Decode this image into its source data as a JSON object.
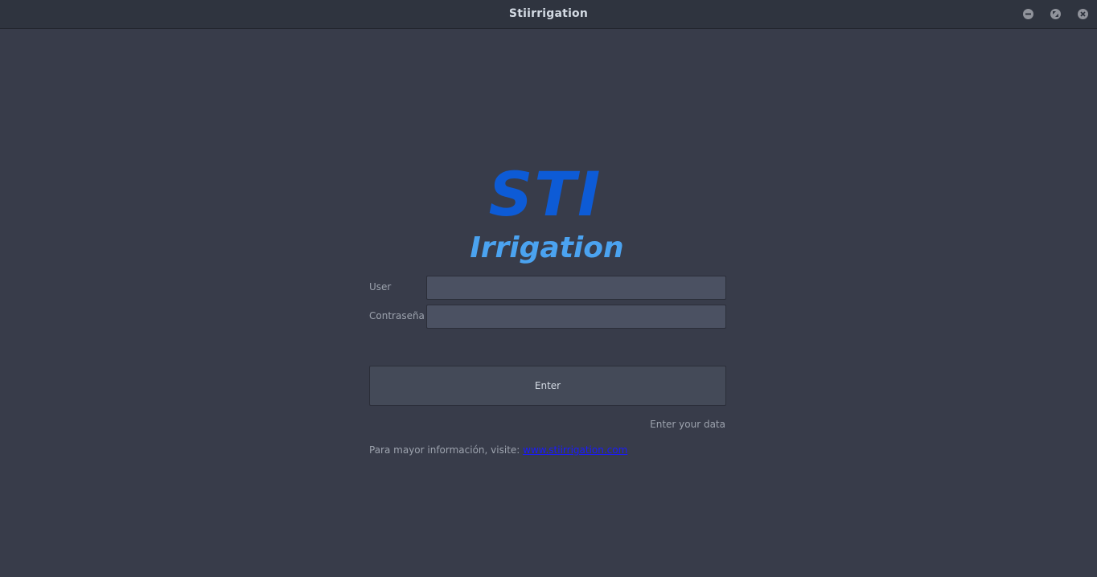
{
  "window": {
    "title": "Stiirrigation",
    "controls": [
      "minimize-icon",
      "maximize-icon",
      "close-icon"
    ]
  },
  "logo": {
    "line1": "STI",
    "line2": "Irrigation",
    "colors": {
      "line1": "#0d5bd6",
      "line2": "#4ba3f0"
    }
  },
  "form": {
    "user_label": "User",
    "user_value": "",
    "password_label": "Contraseña",
    "password_value": "",
    "enter_label": "Enter",
    "status_text": "Enter your data"
  },
  "footer": {
    "info_text": "Para mayor información, visite: ",
    "link_text": "www.stiirrigation.com",
    "link_color": "#1a1aff"
  },
  "theme": {
    "background": "#383c4a",
    "titlebar": "#2f343f",
    "field_bg": "#4b5162",
    "button_bg": "#444a58",
    "text": "#d3dae3"
  }
}
